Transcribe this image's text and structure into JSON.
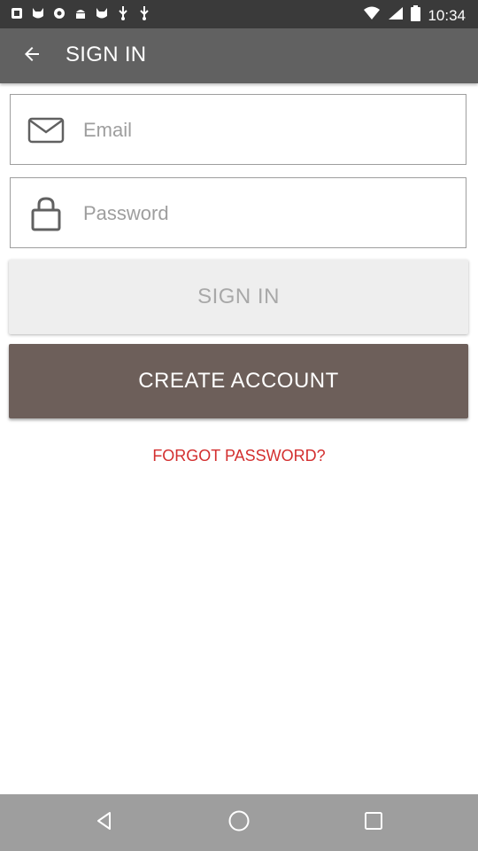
{
  "status_bar": {
    "time": "10:34",
    "icons": [
      "notification-icon",
      "cat-icon",
      "settings-icon",
      "android-icon",
      "cat-icon",
      "usb-icon",
      "usb-icon",
      "wifi-icon",
      "signal-icon",
      "battery-icon"
    ]
  },
  "app_bar": {
    "title": "SIGN IN",
    "back_icon": "arrow-left-icon"
  },
  "form": {
    "email": {
      "placeholder": "Email",
      "value": "",
      "icon": "envelope-icon"
    },
    "password": {
      "placeholder": "Password",
      "value": "",
      "icon": "lock-icon"
    },
    "signin_label": "SIGN IN",
    "create_label": "CREATE ACCOUNT",
    "forgot_label": "FORGOT PASSWORD?"
  },
  "nav_bar": {
    "icons": [
      "back-triangle-icon",
      "home-circle-icon",
      "recents-square-icon"
    ]
  },
  "colors": {
    "app_bar": "#616161",
    "create_button": "#6d5f5a",
    "forgot_link": "#d32f2f",
    "nav_bar": "#9e9e9e"
  }
}
